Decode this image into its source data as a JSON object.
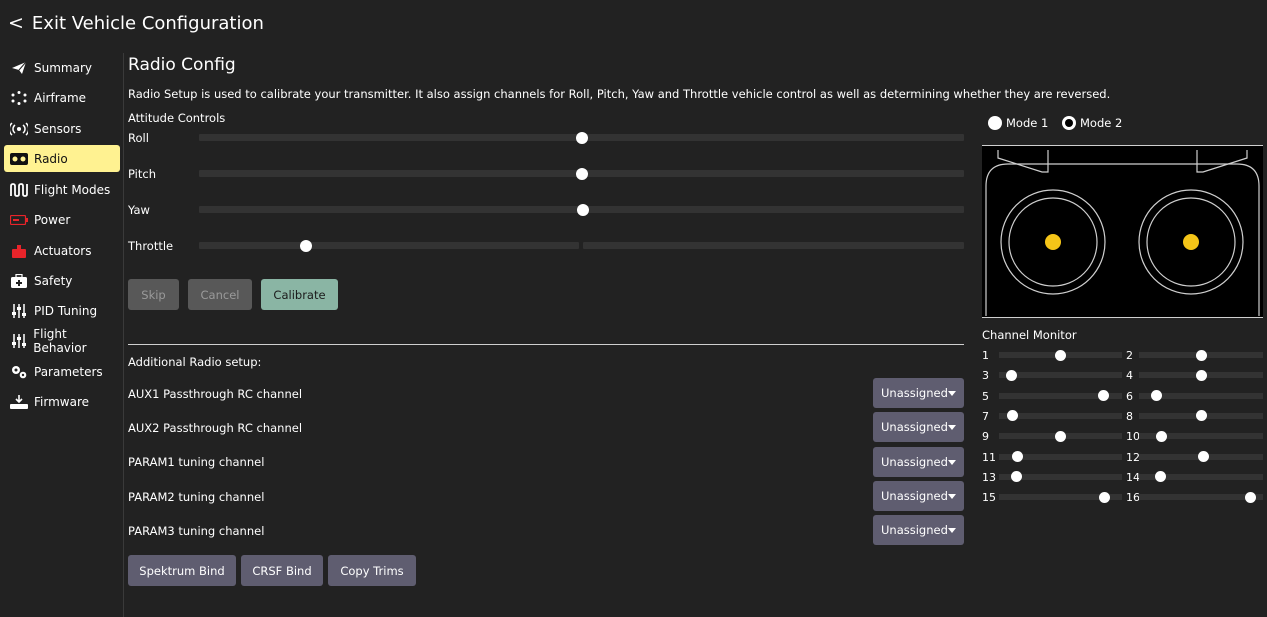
{
  "header": {
    "back_glyph": "<",
    "title": "Exit Vehicle Configuration"
  },
  "sidebar": {
    "items": [
      {
        "label": "Summary",
        "icon": "paper-plane-icon",
        "active": false
      },
      {
        "label": "Airframe",
        "icon": "airframe-icon",
        "active": false
      },
      {
        "label": "Sensors",
        "icon": "sensors-icon",
        "active": false
      },
      {
        "label": "Radio",
        "icon": "radio-icon",
        "active": true
      },
      {
        "label": "Flight Modes",
        "icon": "flight-modes-icon",
        "active": false
      },
      {
        "label": "Power",
        "icon": "battery-icon",
        "active": false
      },
      {
        "label": "Actuators",
        "icon": "actuators-icon",
        "active": false
      },
      {
        "label": "Safety",
        "icon": "safety-icon",
        "active": false
      },
      {
        "label": "PID Tuning",
        "icon": "sliders-icon",
        "active": false
      },
      {
        "label": "Flight Behavior",
        "icon": "sliders-icon",
        "active": false
      },
      {
        "label": "Parameters",
        "icon": "gears-icon",
        "active": false
      },
      {
        "label": "Firmware",
        "icon": "firmware-icon",
        "active": false
      }
    ]
  },
  "main": {
    "title": "Radio Config",
    "description": "Radio Setup is used to calibrate your transmitter. It also assign channels for Roll, Pitch, Yaw and Throttle vehicle control as well as determining whether they are reversed.",
    "attitude_label": "Attitude Controls",
    "controls": [
      {
        "label": "Roll",
        "value": 0.5
      },
      {
        "label": "Pitch",
        "value": 0.5
      },
      {
        "label": "Yaw",
        "value": 0.502
      },
      {
        "label": "Throttle",
        "value": 0.14
      }
    ],
    "buttons": {
      "skip": "Skip",
      "cancel": "Cancel",
      "calibrate": "Calibrate"
    },
    "additional_label": "Additional Radio setup:",
    "additional_rows": [
      {
        "label": "AUX1 Passthrough RC channel",
        "value": "Unassigned"
      },
      {
        "label": "AUX2 Passthrough RC channel",
        "value": "Unassigned"
      },
      {
        "label": "PARAM1 tuning channel",
        "value": "Unassigned"
      },
      {
        "label": "PARAM2 tuning channel",
        "value": "Unassigned"
      },
      {
        "label": "PARAM3 tuning channel",
        "value": "Unassigned"
      }
    ],
    "bind_buttons": {
      "spektrum": "Spektrum Bind",
      "crsf": "CRSF Bind",
      "copy_trims": "Copy Trims"
    }
  },
  "right": {
    "mode1": "Mode 1",
    "mode2": "Mode 2",
    "selected_mode": "Mode 2",
    "channel_monitor_title": "Channel Monitor",
    "channels": [
      {
        "num": "1",
        "value": 0.5
      },
      {
        "num": "2",
        "value": 0.5
      },
      {
        "num": "3",
        "value": 0.1
      },
      {
        "num": "4",
        "value": 0.5
      },
      {
        "num": "5",
        "value": 0.85
      },
      {
        "num": "6",
        "value": 0.14
      },
      {
        "num": "7",
        "value": 0.11
      },
      {
        "num": "8",
        "value": 0.5
      },
      {
        "num": "9",
        "value": 0.5
      },
      {
        "num": "10",
        "value": 0.18
      },
      {
        "num": "11",
        "value": 0.15
      },
      {
        "num": "12",
        "value": 0.52
      },
      {
        "num": "13",
        "value": 0.14
      },
      {
        "num": "14",
        "value": 0.17
      },
      {
        "num": "15",
        "value": 0.86
      },
      {
        "num": "16",
        "value": 0.9
      }
    ]
  },
  "colors": {
    "accent_active": "#fff291",
    "calibrate": "#8ab5a4",
    "dropdown": "#5f5d70",
    "stick": "#f5c518"
  }
}
